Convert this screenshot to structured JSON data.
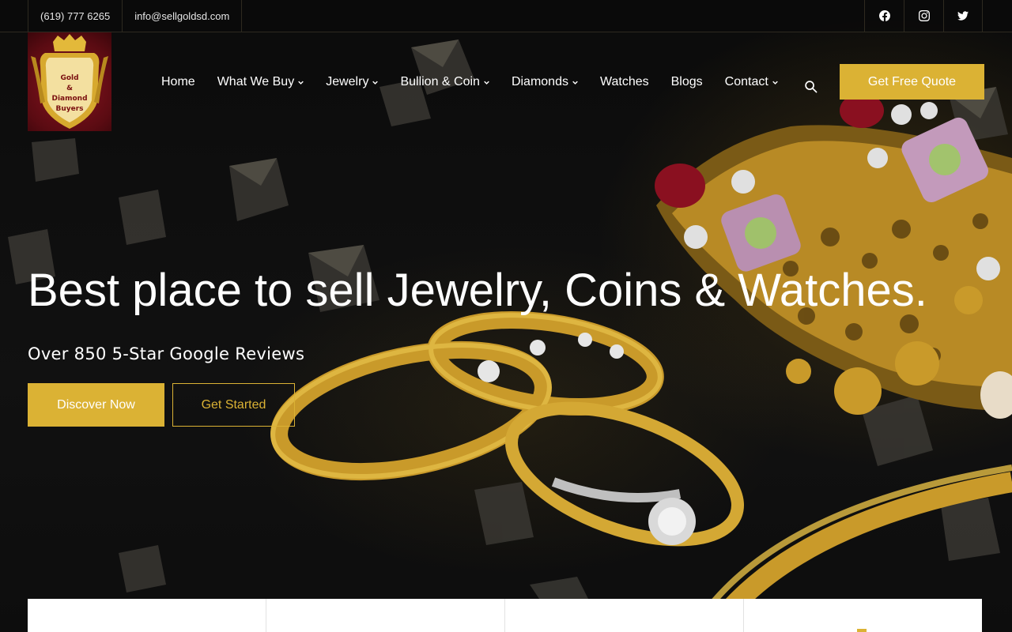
{
  "topbar": {
    "phone": "(619) 777 6265",
    "email": "info@sellgoldsd.com",
    "social": [
      {
        "name": "facebook-icon"
      },
      {
        "name": "instagram-icon"
      },
      {
        "name": "twitter-icon"
      }
    ]
  },
  "logo": {
    "line1": "Gold",
    "line2": "&",
    "line3": "Diamond",
    "line4": "Buyers"
  },
  "nav": {
    "items": [
      {
        "label": "Home",
        "dropdown": false
      },
      {
        "label": "What We Buy",
        "dropdown": true
      },
      {
        "label": "Jewelry",
        "dropdown": true
      },
      {
        "label": "Bullion & Coin",
        "dropdown": true
      },
      {
        "label": "Diamonds",
        "dropdown": true
      },
      {
        "label": "Watches",
        "dropdown": false
      },
      {
        "label": "Blogs",
        "dropdown": false
      },
      {
        "label": "Contact",
        "dropdown": true
      }
    ],
    "search_icon": "search-icon",
    "cta_label": "Get Free Quote"
  },
  "hero": {
    "title": "Best place to sell Jewelry, Coins & Watches.",
    "subtitle": "Over 850 5-Star Google Reviews",
    "primary_button": "Discover Now",
    "secondary_button": "Get Started"
  },
  "colors": {
    "accent": "#dbb234",
    "background": "#0c0c0c",
    "logo_red": "#7a1010"
  }
}
